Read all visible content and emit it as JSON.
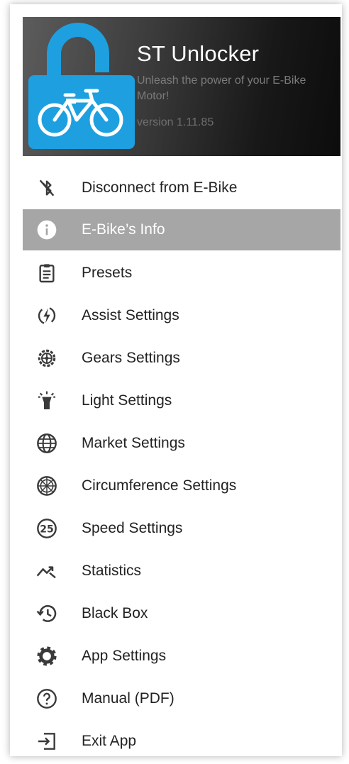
{
  "header": {
    "app_name": "ST Unlocker",
    "tagline": "Unleash the power of your E-Bike Motor!",
    "version": "version 1.11.85",
    "brand_color": "#1e9fe0"
  },
  "menu": {
    "active_color": "#a6a6a6",
    "items": [
      {
        "label": "Disconnect from E-Bike",
        "icon": "bluetooth-disabled-icon"
      },
      {
        "label": "E-Bike’s Info",
        "icon": "info-icon",
        "active": true
      },
      {
        "label": "Presets",
        "icon": "clipboard-icon"
      },
      {
        "label": "Assist Settings",
        "icon": "lightning-circle-icon"
      },
      {
        "label": "Gears Settings",
        "icon": "gear-wheel-icon"
      },
      {
        "label": "Light Settings",
        "icon": "lamp-icon"
      },
      {
        "label": "Market Settings",
        "icon": "globe-icon"
      },
      {
        "label": "Circumference Settings",
        "icon": "wheel-icon"
      },
      {
        "label": "Speed Settings",
        "icon": "speed-25-icon"
      },
      {
        "label": "Statistics",
        "icon": "trending-icon"
      },
      {
        "label": "Black Box",
        "icon": "history-icon"
      },
      {
        "label": "App Settings",
        "icon": "cog-icon"
      },
      {
        "label": "Manual (PDF)",
        "icon": "help-circle-icon"
      },
      {
        "label": "Exit App",
        "icon": "exit-icon"
      }
    ]
  }
}
